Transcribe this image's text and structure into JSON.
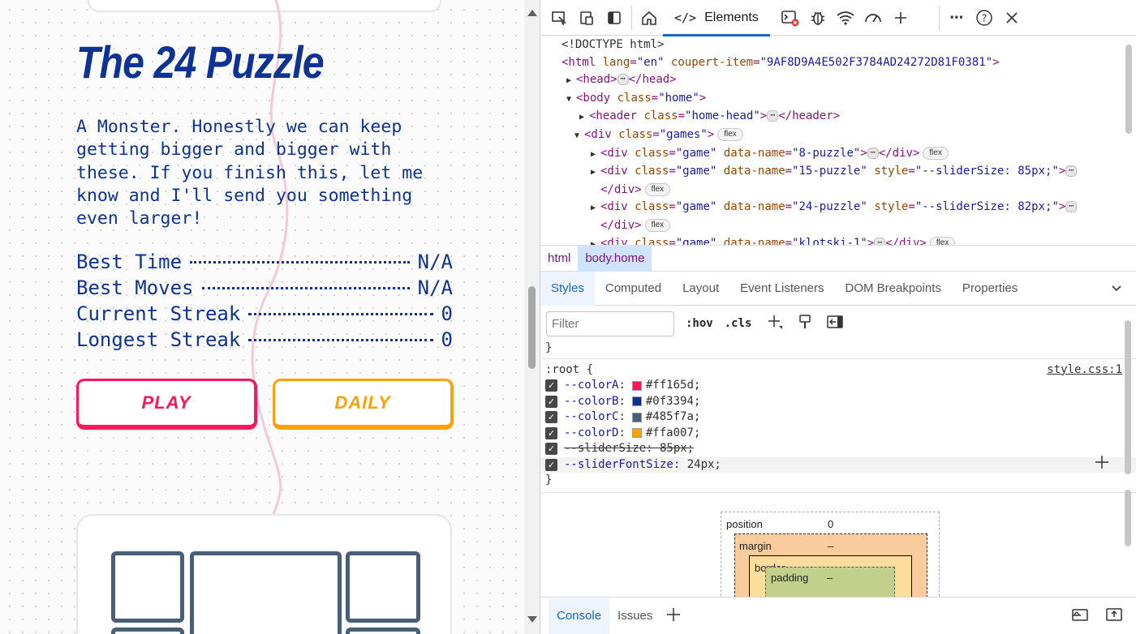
{
  "page": {
    "title": "The 24 Puzzle",
    "description": "A Monster. Honestly we can keep getting bigger and bigger with these. If you finish this, let me know and I'll send you something even larger!",
    "stats": [
      {
        "label": "Best Time",
        "value": "N/A"
      },
      {
        "label": "Best Moves",
        "value": "N/A"
      },
      {
        "label": "Current Streak",
        "value": "0"
      },
      {
        "label": "Longest Streak",
        "value": "0"
      }
    ],
    "play_label": "PLAY",
    "daily_label": "DAILY"
  },
  "devtools": {
    "elements_tab": "Elements",
    "dom": {
      "doctype": "<!DOCTYPE html>",
      "html_open_tag": "<html",
      "lang_attr": "lang",
      "lang_val": "\"en\"",
      "coupert_attr": "coupert-item",
      "coupert_val": "\"9AF8D9A4E502F3784AD24272D81F0381\"",
      "head_open": "<head>",
      "head_close": "</head>",
      "body_open": "<body",
      "body_class_attr": "class",
      "body_class_val": "\"home\"",
      "header_open": "<header",
      "header_class_val": "\"home-head\"",
      "header_close": "</header>",
      "div_open": "<div",
      "games_class_val": "\"games\"",
      "game_class_val": "\"game\"",
      "data_name_attr": "data-name",
      "style_attr": "style",
      "div_close": "</div>",
      "flex_pill": "flex",
      "game1": "\"8-puzzle\"",
      "game2": "\"15-puzzle\"",
      "game2_style": "\"--sliderSize: 85px;\"",
      "game3": "\"24-puzzle\"",
      "game3_style": "\"--sliderSize: 82px;\"",
      "game4": "\"klotski-1\""
    },
    "breadcrumbs": [
      "html",
      "body.home"
    ],
    "subtabs": [
      "Styles",
      "Computed",
      "Layout",
      "Event Listeners",
      "DOM Breakpoints",
      "Properties"
    ],
    "filter_placeholder": "Filter",
    "hov": ":hov",
    "cls": ".cls",
    "styles": {
      "closing_brace_top": "}",
      "selector": ":root",
      "open_brace": "{",
      "source": "style.css:1",
      "vars": [
        {
          "name": "--colorA",
          "value": "#ff165d",
          "color": "#ff165d"
        },
        {
          "name": "--colorB",
          "value": "#0f3394",
          "color": "#0f3394"
        },
        {
          "name": "--colorC",
          "value": "#485f7a",
          "color": "#485f7a"
        },
        {
          "name": "--colorD",
          "value": "#ffa007",
          "color": "#ffa007"
        }
      ],
      "slider_size": "--sliderSize: 85px;",
      "slider_font_name": "--sliderFontSize",
      "slider_font_val": "24px;",
      "closing_brace": "}"
    },
    "box_model": {
      "position_label": "position",
      "position_val": "0",
      "margin_label": "margin",
      "margin_val": "–",
      "border_label": "border",
      "border_val": "–",
      "padding_label": "padding",
      "padding_val": "–"
    },
    "bottom_tabs": [
      "Console",
      "Issues"
    ]
  },
  "colors": {
    "colorA": "#ff165d",
    "colorB": "#0f3394",
    "colorC": "#485f7a",
    "colorD": "#ffa007",
    "accent": "#1a66c9"
  }
}
